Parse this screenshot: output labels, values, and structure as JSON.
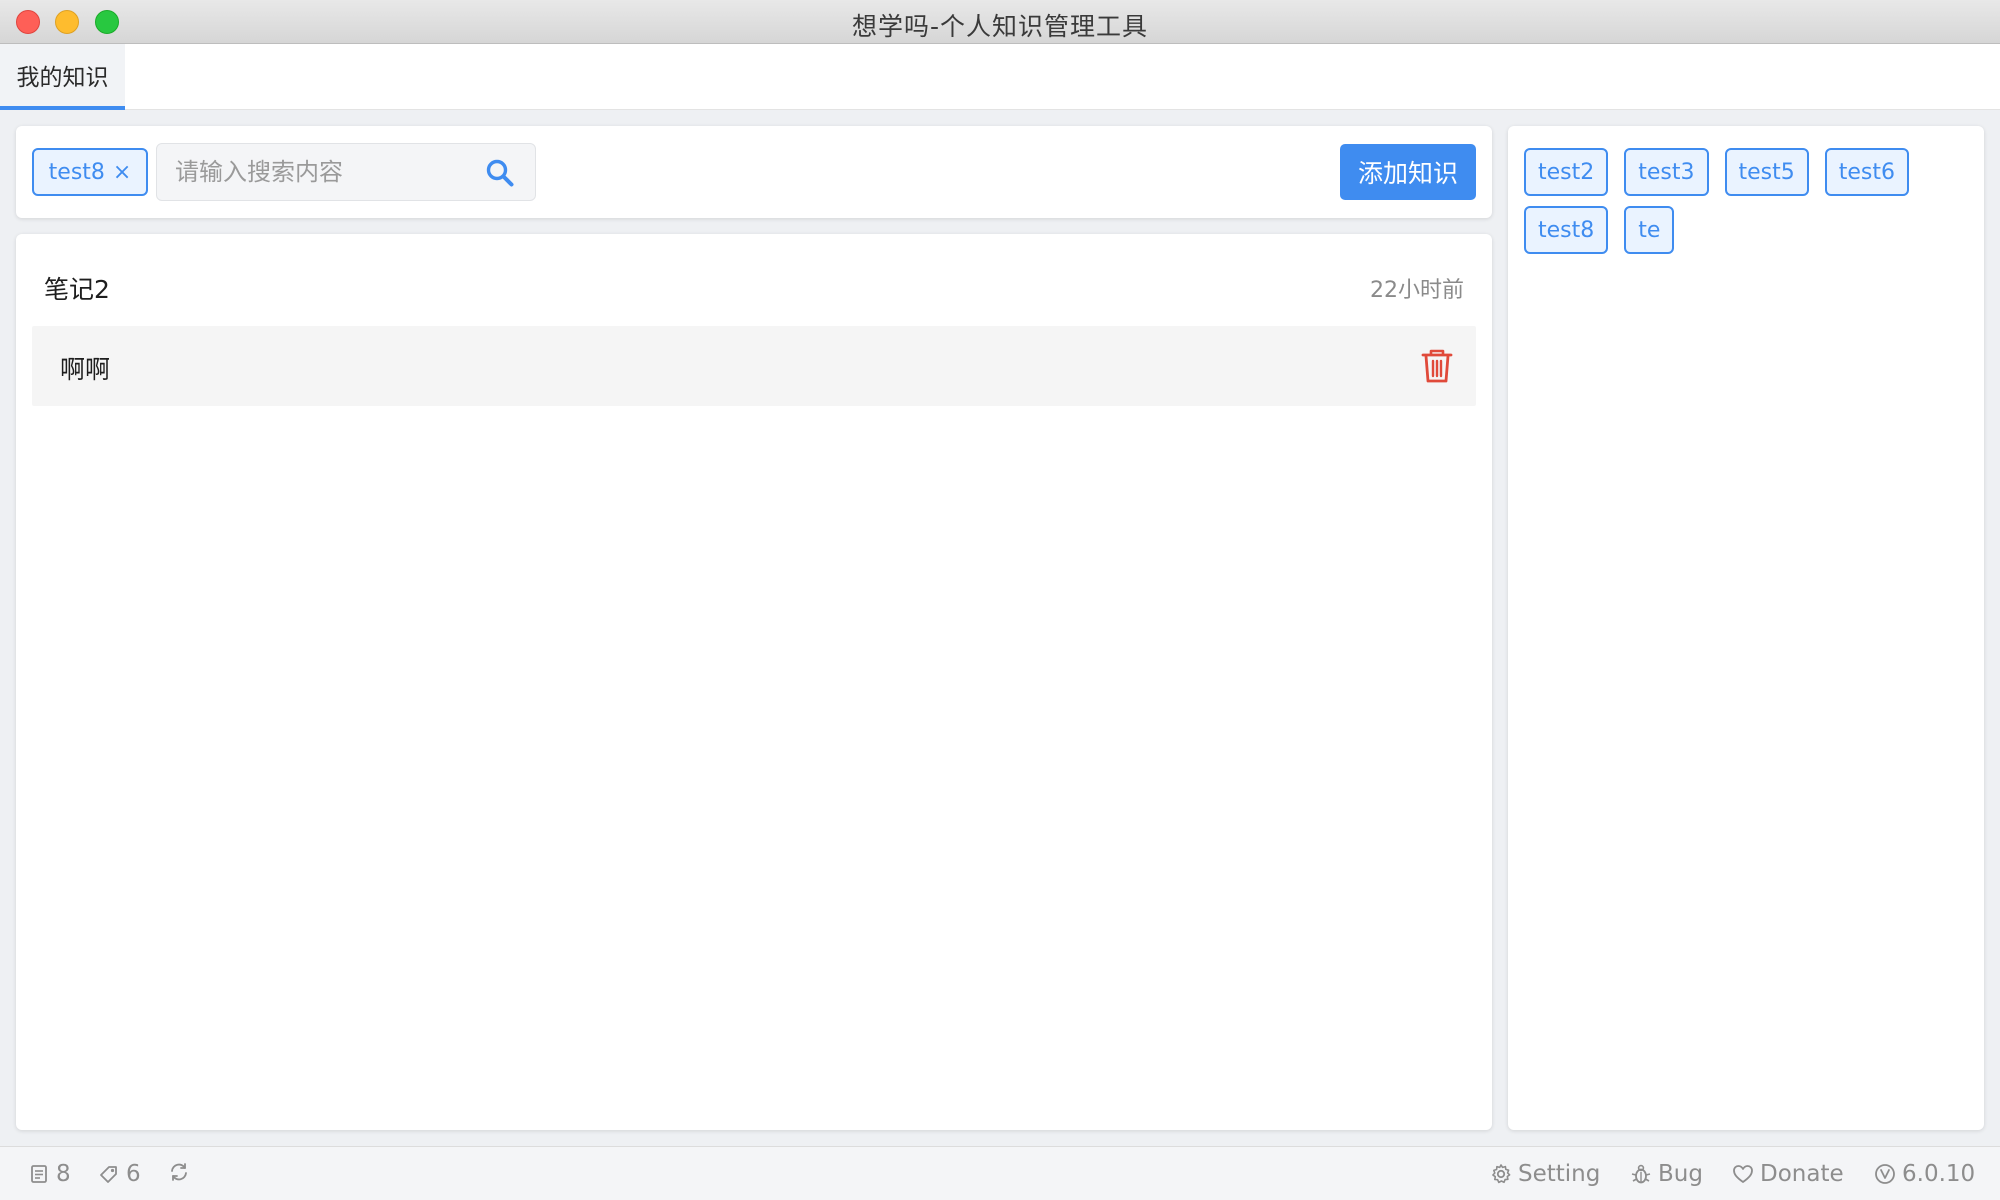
{
  "window": {
    "title": "想学吗-个人知识管理工具"
  },
  "tabs": [
    {
      "label": "我的知识",
      "active": true
    }
  ],
  "search": {
    "active_filter_tag": "test8",
    "active_filter_remove": "×",
    "placeholder": "请输入搜索内容",
    "value": "",
    "add_button_label": "添加知识"
  },
  "notes": [
    {
      "title": "笔记2",
      "time": "22小时前",
      "content": "啊啊"
    }
  ],
  "tags": [
    "test2",
    "test3",
    "test5",
    "test6",
    "test8",
    "te"
  ],
  "statusbar": {
    "note_count": "8",
    "tag_count": "6",
    "setting_label": "Setting",
    "bug_label": "Bug",
    "donate_label": "Donate",
    "version": "6.0.10"
  },
  "colors": {
    "accent": "#3f8cf0",
    "delete": "#e04a3a",
    "muted_text": "#8d8d8d"
  },
  "icons": {
    "search": "search-icon",
    "delete": "trash-icon",
    "notes": "document-icon",
    "tags": "tag-icon",
    "sync": "sync-icon",
    "setting": "gear-icon",
    "bug": "bug-icon",
    "donate": "heart-icon",
    "version": "version-icon"
  }
}
